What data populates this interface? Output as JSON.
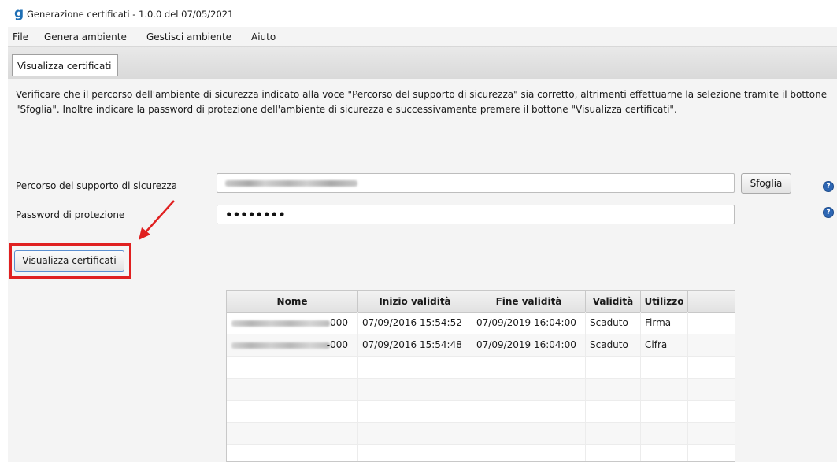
{
  "window": {
    "title": "Generazione certificati - 1.0.0 del 07/05/2021",
    "icon": "app-logo-g"
  },
  "menu": {
    "items": [
      "File",
      "Genera ambiente",
      "Gestisci ambiente",
      "Aiuto"
    ]
  },
  "tabs": [
    {
      "label": "Visualizza certificati",
      "active": true
    }
  ],
  "main": {
    "description": "Verificare che il percorso dell'ambiente di sicurezza indicato alla voce \"Percorso del supporto di sicurezza\" sia corretto, altrimenti effettuarne la selezione tramite il bottone \"Sfoglia\". Inoltre indicare la password di protezione dell'ambiente di sicurezza e successivamente premere il bottone \"Visualizza certificati\".",
    "path_label": "Percorso del supporto di sicurezza",
    "path_value_redacted": true,
    "browse_label": "Sfoglia",
    "password_label": "Password di protezione",
    "password_value": "••••••••",
    "show_button_label": "Visualizza certificati",
    "help_glyph": "?"
  },
  "table": {
    "columns": [
      "Nome",
      "Inizio validità",
      "Fine validità",
      "Validità",
      "Utilizzo",
      ""
    ],
    "rows": [
      {
        "nome_suffix": "-000",
        "inizio": "07/09/2016 15:54:52",
        "fine": "07/09/2019 16:04:00",
        "validita": "Scaduto",
        "utilizzo": "Firma"
      },
      {
        "nome_suffix": "-000",
        "inizio": "07/09/2016 15:54:48",
        "fine": "07/09/2019 16:04:00",
        "validita": "Scaduto",
        "utilizzo": "Cifra"
      }
    ]
  },
  "colors": {
    "accent": "#1f6fb5",
    "highlight": "#e02020",
    "help_icon": "#2d66b3"
  }
}
